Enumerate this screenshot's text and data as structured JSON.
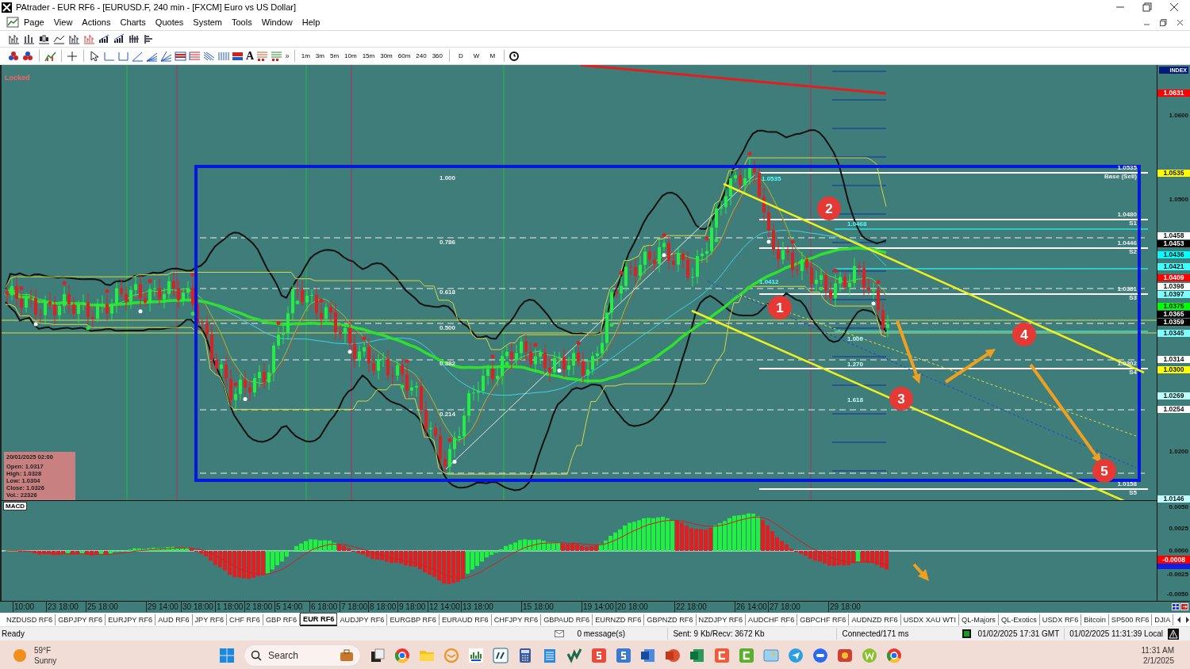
{
  "window": {
    "title": "PAtrader - EUR RF6 - [EURUSD.F, 240 min - [FXCM] Euro vs US Dollar]"
  },
  "menu": [
    "Page",
    "View",
    "Actions",
    "Charts",
    "Quotes",
    "System",
    "Tools",
    "Window",
    "Help"
  ],
  "toolbar": {
    "text_tool": "A",
    "more": "»",
    "timeframes": [
      "1m",
      "3m",
      "5m",
      "10m",
      "15m",
      "30m",
      "60m",
      "240",
      "360"
    ],
    "periods": [
      "D",
      "W",
      "M"
    ]
  },
  "chart": {
    "status": "Locked",
    "index_label": "INDEX",
    "price_ticks": [
      "1.0600",
      "1.0500",
      "1.0200"
    ],
    "price_tags": [
      {
        "text": "1.0631",
        "color": "#ff0000"
      },
      {
        "text": "1.0535",
        "color": "#ffff00"
      },
      {
        "text": "1.0458",
        "color": "#ffffff"
      },
      {
        "text": "1.0453",
        "color": "#000000"
      },
      {
        "text": "1.0436",
        "color": "#00ffff"
      },
      {
        "text": "1.0421",
        "color": "#40ffff"
      },
      {
        "text": "1.0409",
        "color": "#ff0000"
      },
      {
        "text": "1.0398",
        "color": "#ffffff"
      },
      {
        "text": "1.0397",
        "color": "#80ffff"
      },
      {
        "text": "1.0375",
        "color": "#00ff00"
      },
      {
        "text": "1.0365",
        "color": "#000000"
      },
      {
        "text": "1.0359",
        "color": "#000000"
      },
      {
        "text": "1.0345",
        "color": "#80ffff"
      },
      {
        "text": "1.0314",
        "color": "#ffffff"
      },
      {
        "text": "1.0300",
        "color": "#ffff00"
      },
      {
        "text": "1.0269",
        "color": "#c0ffff"
      },
      {
        "text": "1.0254",
        "color": "#ffffff"
      },
      {
        "text": "1.0146",
        "color": "#c0ffff"
      }
    ],
    "fib_levels": [
      "1.000",
      "0.786",
      "0.618",
      "0.500",
      "0.382",
      "0.214"
    ],
    "level_labels": [
      {
        "value": "1.0535",
        "label": "Base (Sell)"
      },
      {
        "value": "1.0480",
        "label": "S1"
      },
      {
        "value": "1.0446",
        "label": "S2"
      },
      {
        "value": "1.0381",
        "label": "S3"
      },
      {
        "value": "1.0302",
        "label": "S4"
      },
      {
        "value": "1.0158",
        "label": "S5"
      }
    ],
    "extension_labels": [
      "1.000",
      "1.270",
      "1.618"
    ],
    "swing_labels": [
      "1.0535",
      "1.0468",
      "1.0412"
    ],
    "annotations": [
      "1",
      "2",
      "3",
      "4",
      "5"
    ],
    "info_box": {
      "title": "20/01/2025 02:00",
      "lines": [
        "Open: 1.0317",
        "High: 1.0328",
        "Low: 1.0304",
        "Close: 1.0326",
        "Vol.: 22326"
      ]
    }
  },
  "macd": {
    "label": "MACD",
    "ticks": [
      "0.0050",
      "0.0025",
      "0.0000",
      "-0.0025",
      "-0.0050"
    ],
    "tags": [
      {
        "text": "-0.0008",
        "color": "#ff0000"
      }
    ]
  },
  "time_axis": [
    "10:00",
    "23 18:00",
    "25 18:00",
    "29 14:00",
    "30 18:00",
    "1 18:00",
    "2 18:00",
    "5 14:00",
    "6 18:00",
    "7 18:00",
    "8 18:00",
    "9 18:00",
    "12 14:00",
    "13 18:00",
    "15 18:00",
    "19 14:00",
    "20 18:00",
    "22 18:00",
    "26 14:00",
    "27 18:00",
    "29 18:00"
  ],
  "tabs": [
    {
      "label": "NZDUSD RF6",
      "selected": false
    },
    {
      "label": "GBPJPY RF6",
      "selected": false
    },
    {
      "label": "EURJPY RF6",
      "selected": false
    },
    {
      "label": "AUD RF6",
      "selected": false
    },
    {
      "label": "JPY RF6",
      "selected": false
    },
    {
      "label": "CHF RF6",
      "selected": false
    },
    {
      "label": "GBP RF6",
      "selected": false
    },
    {
      "label": "EUR RF6",
      "selected": true
    },
    {
      "label": "AUDJPY RF6",
      "selected": false
    },
    {
      "label": "EURGBP RF6",
      "selected": false
    },
    {
      "label": "EURAUD RF6",
      "selected": false
    },
    {
      "label": "CHFJPY RF6",
      "selected": false
    },
    {
      "label": "GBPAUD RF6",
      "selected": false
    },
    {
      "label": "EURNZD RF6",
      "selected": false
    },
    {
      "label": "GBPNZD RF6",
      "selected": false
    },
    {
      "label": "NZDJPY RF6",
      "selected": false
    },
    {
      "label": "AUDCHF RF6",
      "selected": false
    },
    {
      "label": "GBPCHF RF6",
      "selected": false
    },
    {
      "label": "AUDNZD RF6",
      "selected": false
    },
    {
      "label": "USDX XAU WTI",
      "selected": false
    },
    {
      "label": "QL-Majors",
      "selected": false
    },
    {
      "label": "QL-Exotics",
      "selected": false
    },
    {
      "label": "USDX  RF6",
      "selected": false
    },
    {
      "label": "Bitcoin",
      "selected": false
    },
    {
      "label": "SP500 RF6",
      "selected": false
    },
    {
      "label": "DJIA",
      "selected": false
    }
  ],
  "status_bar": {
    "state": "Ready",
    "messages": "0 message(s)",
    "traffic": "Sent: 9 Kb/Recv: 3672 Kb",
    "connection": "Connected/171 ms",
    "gmt_time": "01/02/2025 17:31 GMT",
    "local_time": "01/02/2025 11:31:39 Local"
  },
  "taskbar": {
    "temperature": "59°F",
    "weather": "Sunny",
    "search": "Search",
    "time": "11:31 AM",
    "date": "2/1/2025"
  }
}
